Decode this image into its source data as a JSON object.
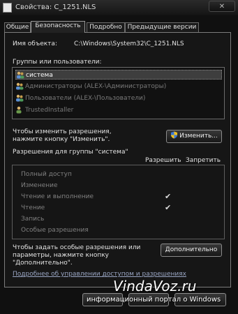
{
  "window": {
    "title": "Свойства: C_1251.NLS"
  },
  "tabs": [
    {
      "label": "Общие"
    },
    {
      "label": "Безопасность"
    },
    {
      "label": "Подробно"
    },
    {
      "label": "Предыдущие версии"
    }
  ],
  "object": {
    "label": "Имя объекта:",
    "value": "C:\\Windows\\System32\\C_1251.NLS"
  },
  "groups": {
    "label": "Группы или пользователи:",
    "items": [
      {
        "name": "система"
      },
      {
        "name": "Администраторы (ALEX-\\Администраторы)"
      },
      {
        "name": "Пользователи (ALEX-\\Пользователи)"
      },
      {
        "name": "TrustedInstaller"
      }
    ]
  },
  "change": {
    "hint_line1": "Чтобы изменить разрешения,",
    "hint_line2": "нажмите кнопку \"Изменить\".",
    "button_label": "Изменить..."
  },
  "permissions": {
    "header": "Разрешения для группы \"система\"",
    "allow_col": "Разрешить",
    "deny_col": "Запретить",
    "rows": [
      {
        "name": "Полный доступ",
        "allow": false
      },
      {
        "name": "Изменение",
        "allow": false
      },
      {
        "name": "Чтение и выполнение",
        "allow": true
      },
      {
        "name": "Чтение",
        "allow": true
      },
      {
        "name": "Запись",
        "allow": false
      },
      {
        "name": "Особые разрешения",
        "allow": false
      }
    ],
    "check_glyph": "✔"
  },
  "advanced": {
    "hint_line1": "Чтобы задать особые разрешения или",
    "hint_line2": "параметры, нажмите кнопку",
    "hint_line3": "\"Дополнительно\".",
    "button_label": "Дополнительно"
  },
  "more_link": "Подробнее об управлении доступом и разрешениях",
  "watermark": {
    "site": "VindaVoz.ru",
    "tagline": "информационный портал о Windows"
  },
  "colors": {
    "background": "#101010",
    "panel_border": "#7c7c7c",
    "link": "#9aa6c4"
  }
}
